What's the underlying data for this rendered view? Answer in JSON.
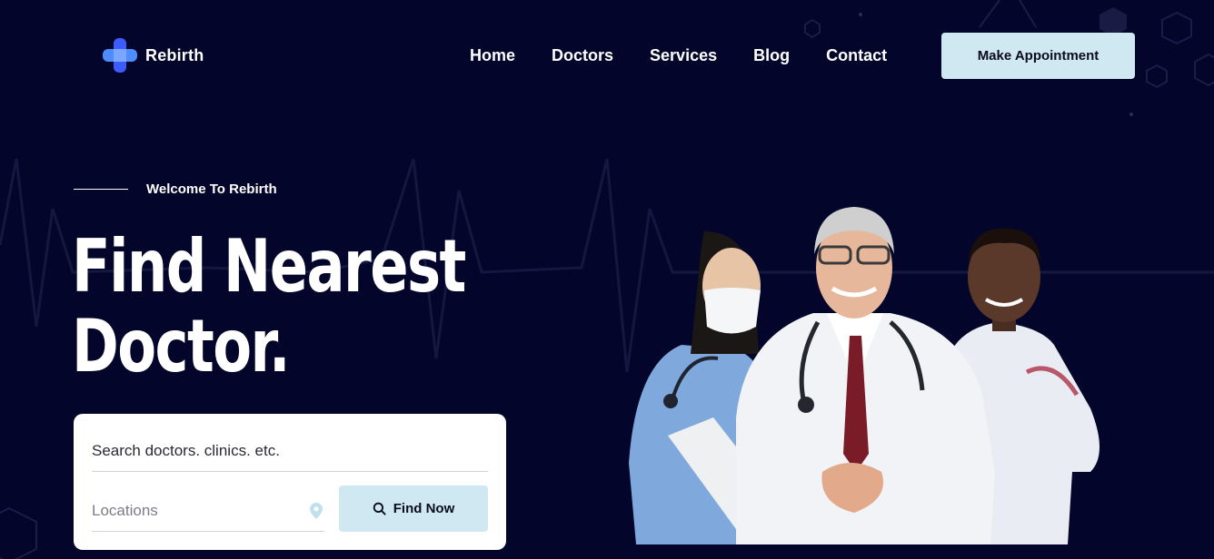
{
  "brand": {
    "name": "Rebirth"
  },
  "nav": {
    "items": [
      {
        "label": "Home"
      },
      {
        "label": "Doctors"
      },
      {
        "label": "Services"
      },
      {
        "label": "Blog"
      },
      {
        "label": "Contact"
      }
    ],
    "cta_label": "Make Appointment"
  },
  "hero": {
    "eyebrow": "Welcome To Rebirth",
    "title_line1": "Find Nearest",
    "title_line2": "Doctor."
  },
  "search": {
    "query_placeholder": "Search doctors. clinics. etc.",
    "location_placeholder": "Locations",
    "button_label": "Find Now"
  },
  "colors": {
    "background": "#03052a",
    "button": "#cfe8f1",
    "logo_accent": "#5b7cff"
  }
}
